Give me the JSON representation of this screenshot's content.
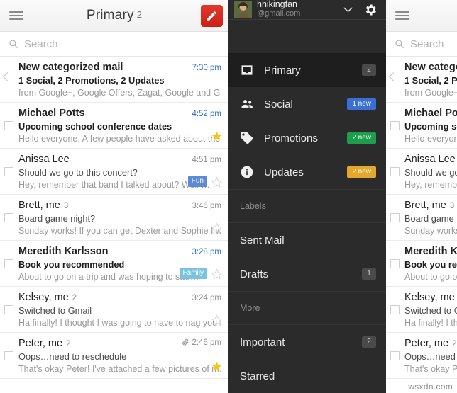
{
  "app": {
    "title": "Primary",
    "title_count": "2",
    "menu_icon": "hamburger-icon",
    "compose_icon": "pencil-icon",
    "compose_color": "#d93025"
  },
  "search": {
    "placeholder": "Search",
    "icon": "search-icon"
  },
  "messages": [
    {
      "leading": "chevron",
      "sender": "New categorized mail",
      "count": "",
      "time": "7:30 pm",
      "subject": "1 Social, 2 Promotions, 2 Updates",
      "snippet": "from Google+, Google Offers, Zagat, Google and G…",
      "unread": true,
      "starred": false,
      "attachment": false,
      "tag": null
    },
    {
      "leading": "checkbox",
      "sender": "Michael Potts",
      "count": "",
      "time": "4:52 pm",
      "subject": "Upcoming school conference dates",
      "snippet": "Hello everyone, A few people have asked about the …",
      "unread": true,
      "starred": true,
      "attachment": false,
      "tag": null
    },
    {
      "leading": "checkbox",
      "sender": "Anissa Lee",
      "count": "",
      "time": "4:51 pm",
      "subject": "Should we go to this concert?",
      "snippet": "Hey, remember that band I talked about? Well …",
      "unread": false,
      "starred": false,
      "attachment": false,
      "tag": {
        "label": "Fun",
        "color": "#5b8ad6"
      }
    },
    {
      "leading": "checkbox",
      "sender": "Brett, me",
      "count": "3",
      "time": "3:46 pm",
      "subject": "Board game night?",
      "snippet": "Sunday works! If you can get Dexter and Sophie I wi…",
      "unread": false,
      "starred": false,
      "attachment": false,
      "tag": null
    },
    {
      "leading": "checkbox",
      "sender": "Meredith Karlsson",
      "count": "",
      "time": "3:28 pm",
      "subject": "Book you recommended",
      "snippet": "About to go on a trip and was hoping to star…",
      "unread": true,
      "starred": false,
      "attachment": false,
      "tag": {
        "label": "Family",
        "color": "#79c3de"
      }
    },
    {
      "leading": "checkbox",
      "sender": "Kelsey, me",
      "count": "2",
      "time": "3:24 pm",
      "subject": "Switched to Gmail",
      "snippet": "Ha finally! I thought I was going to have to nag you f…",
      "unread": false,
      "starred": false,
      "attachment": false,
      "tag": null
    },
    {
      "leading": "checkbox",
      "sender": "Peter, me",
      "count": "2",
      "time": "2:46 pm",
      "subject": "Oops…need to reschedule",
      "snippet": "That's okay Peter! I've attached a few pictures of m…",
      "unread": false,
      "starred": true,
      "attachment": true,
      "tag": null
    }
  ],
  "drawer": {
    "account": {
      "name": "hhikingfan",
      "email": "@gmail.com",
      "avatar_icon": "avatar",
      "expand_icon": "chevron-down-icon",
      "settings_icon": "gear-icon"
    },
    "items": [
      {
        "label": "Primary",
        "icon": "inbox-icon",
        "badge": "2",
        "badge_style": "plain",
        "selected": true
      },
      {
        "label": "Social",
        "icon": "people-icon",
        "badge": "1 new",
        "badge_style": "blue",
        "selected": false
      },
      {
        "label": "Promotions",
        "icon": "tag-icon",
        "badge": "2 new",
        "badge_style": "green",
        "selected": false
      },
      {
        "label": "Updates",
        "icon": "info-icon",
        "badge": "2 new",
        "badge_style": "amber",
        "selected": false
      }
    ],
    "labels_header": "Labels",
    "labels": [
      {
        "label": "Sent Mail",
        "badge": ""
      },
      {
        "label": "Drafts",
        "badge": "1"
      }
    ],
    "more_header": "More",
    "more": [
      {
        "label": "Important",
        "badge": "2"
      },
      {
        "label": "Starred",
        "badge": ""
      }
    ]
  },
  "watermark": "wsxdn.com"
}
